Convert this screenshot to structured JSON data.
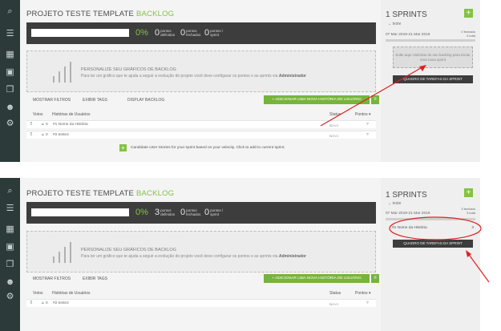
{
  "colors": {
    "accent": "#83c341",
    "sidebar_bg": "#2d3a3a",
    "statbar_bg": "#3d3d3d",
    "annotation": "#e02020"
  },
  "sidebar_icons": [
    "search-icon",
    "backlog-list-icon",
    "kanban-icon",
    "issues-icon",
    "wiki-icon",
    "team-icon",
    "admin-icon"
  ],
  "panels": [
    {
      "title_main": "PROJETO TESTE TEMPLATE",
      "title_highlight": "BACKLOG",
      "stats": {
        "percent": "0%",
        "defined_num": "0",
        "defined_label_1": "pontos",
        "defined_label_2": "definidos",
        "closed_num": "0",
        "closed_label_1": "pontos",
        "closed_label_2": "fechados",
        "sprint_num": "0",
        "sprint_label_1": "pontos /",
        "sprint_label_2": "sprint"
      },
      "graph": {
        "title": "PERSONALIZE SEU GRÁFICOS DE BACKLOG",
        "desc": "Para ter um gráfico que te ajuda a seguir a evolução do projeto você deve configurar os pontos e as sprints via",
        "desc_bold": "Administrador"
      },
      "toolbar": {
        "filters": "MOSTRAR FILTROS",
        "tags": "EXIBIR TAGS",
        "display": "DISPLAY BACKLOG",
        "add": "+ ADICIONAR UMA NOVA HISTÓRIA DE USUÁRIO",
        "menu": "≡"
      },
      "list_header": {
        "votes": "Votos",
        "stories": "Histórias de Usuários",
        "status": "Status",
        "points": "Pontos ▾"
      },
      "rows": [
        {
          "votes": "0",
          "title": "#1 Nome da História",
          "status": "Novo",
          "points": "?"
        },
        {
          "votes": "0",
          "title": "#2 teste2",
          "status": "Novo",
          "points": "?"
        }
      ],
      "suggestion": "Candidate User Stories for your sprint based on your velocity. Click to add to current sprint.",
      "sprint": {
        "title": "1 SPRINTS",
        "name": "teste",
        "dates": "07 Mar 2019-21 Mar 2019",
        "closed_1": "0 fechado",
        "closed_2": "0 total",
        "progress": 0,
        "drop_text": "Solte aqui Histórias do seu backlog para iniciar uma nova sprint",
        "board_button": "QUADRO DE TAREFAS DA SPRINT"
      }
    },
    {
      "title_main": "PROJETO TESTE TEMPLATE",
      "title_highlight": "BACKLOG",
      "stats": {
        "percent": "0%",
        "defined_num": "3",
        "defined_label_1": "pontos",
        "defined_label_2": "definidos",
        "closed_num": "0",
        "closed_label_1": "pontos",
        "closed_label_2": "fechados",
        "sprint_num": "0",
        "sprint_label_1": "pontos /",
        "sprint_label_2": "sprint"
      },
      "graph": {
        "title": "PERSONALIZE SEU GRÁFICOS DE BACKLOG",
        "desc": "Para ter um gráfico que te ajuda a seguir a evolução do projeto você deve configurar os pontos e as sprints via",
        "desc_bold": "Administrador"
      },
      "toolbar": {
        "filters": "MOSTRAR FILTROS",
        "tags": "EXIBIR TAGS",
        "add": "+ ADICIONAR UMA NOVA HISTÓRIA DE USUÁRIO",
        "menu": "≡"
      },
      "list_header": {
        "votes": "Votos",
        "stories": "Histórias de Usuários",
        "status": "Status",
        "points": "Pontos ▾"
      },
      "rows": [
        {
          "votes": "0",
          "title": "#2 teste2",
          "status": "Novo",
          "points": "?"
        }
      ],
      "sprint": {
        "title": "1 SPRINTS",
        "name": "teste",
        "dates": "07 Mar 2019-21 Mar 2019",
        "closed_1": "3 fechado",
        "closed_2": "3 total",
        "progress": 0,
        "story_title": "#1 Nome da História",
        "story_points": "3",
        "board_button": "QUADRO DE TAREFAS DA SPRINT"
      }
    }
  ]
}
